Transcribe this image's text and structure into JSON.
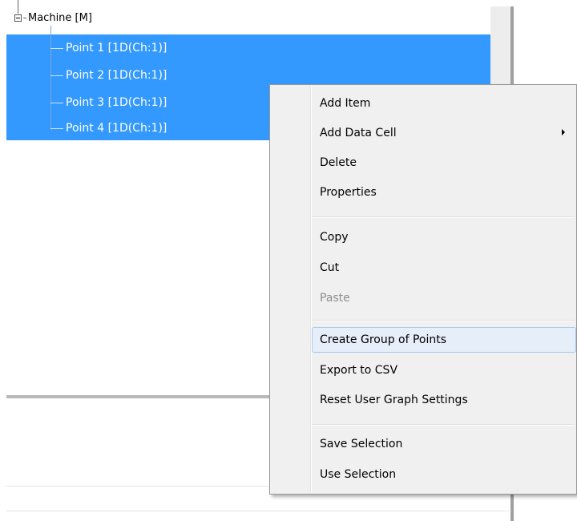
{
  "tree": {
    "root": {
      "label": "Machine [M]"
    },
    "items": [
      {
        "label": "Point 1 [1D(Ch:1)]"
      },
      {
        "label": "Point 2 [1D(Ch:1)]"
      },
      {
        "label": "Point 3 [1D(Ch:1)]"
      },
      {
        "label": "Point 4 [1D(Ch:1)]"
      }
    ],
    "selection_color": "#3399ff"
  },
  "context_menu": {
    "items": [
      {
        "label": "Add Item"
      },
      {
        "label": "Add Data Cell"
      },
      {
        "label": "Delete"
      },
      {
        "label": "Properties"
      },
      {
        "label": "Copy"
      },
      {
        "label": "Cut"
      },
      {
        "label": "Paste"
      },
      {
        "label": "Create Group of Points"
      },
      {
        "label": "Export to CSV"
      },
      {
        "label": "Reset User Graph Settings"
      },
      {
        "label": "Save Selection"
      },
      {
        "label": "Use Selection"
      }
    ],
    "highlight_color": "#e5eef9"
  }
}
